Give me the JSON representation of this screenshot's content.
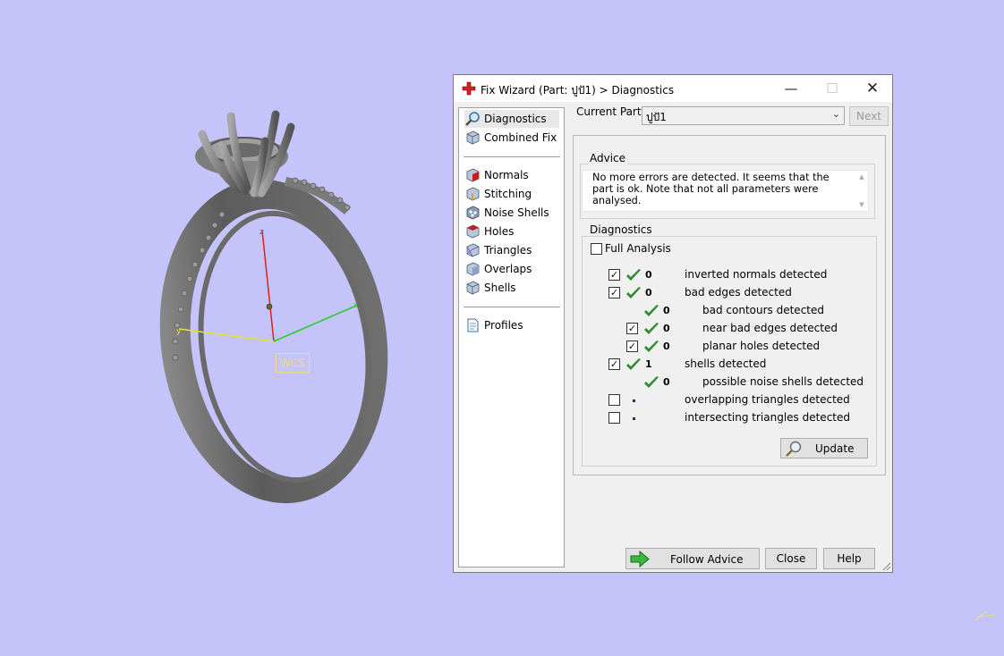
{
  "viewport": {
    "wcs_label": "WCS",
    "axes": {
      "z": "z",
      "x": "x",
      "y": "y"
    }
  },
  "dialog": {
    "title": "Fix Wizard (Part: ปูปั1) > Diagnostics",
    "nav": {
      "items": [
        {
          "label": "Diagnostics",
          "icon": "magnifier-icon",
          "selected": true
        },
        {
          "label": "Combined Fix",
          "icon": "cube-icon"
        },
        {
          "label": "Normals",
          "icon": "normals-cube-icon"
        },
        {
          "label": "Stitching",
          "icon": "stitching-cube-icon"
        },
        {
          "label": "Noise Shells",
          "icon": "noise-shells-icon"
        },
        {
          "label": "Holes",
          "icon": "holes-cube-icon"
        },
        {
          "label": "Triangles",
          "icon": "triangles-cube-icon"
        },
        {
          "label": "Overlaps",
          "icon": "overlaps-cube-icon"
        },
        {
          "label": "Shells",
          "icon": "shells-cube-icon"
        },
        {
          "label": "Profiles",
          "icon": "document-icon"
        }
      ]
    },
    "current_part": {
      "label": "Current Part:",
      "value": "ปูปั1"
    },
    "next_label": "Next",
    "advice": {
      "title": "Advice",
      "text": "No more errors are detected. It seems that the part is ok. Note that not all parameters were analysed."
    },
    "diagnostics": {
      "title": "Diagnostics",
      "full_analysis": {
        "label": "Full Analysis",
        "checked": false
      },
      "rows": [
        {
          "checkbox": true,
          "checked": true,
          "status": "ok",
          "count": "0",
          "text": "inverted normals detected",
          "indent": 0
        },
        {
          "checkbox": true,
          "checked": true,
          "status": "ok",
          "count": "0",
          "text": "bad edges detected",
          "indent": 0
        },
        {
          "checkbox": false,
          "checked": false,
          "status": "ok",
          "count": "0",
          "text": "bad contours detected",
          "indent": 1
        },
        {
          "checkbox": true,
          "checked": true,
          "status": "ok",
          "count": "0",
          "text": "near bad edges detected",
          "indent": 1
        },
        {
          "checkbox": true,
          "checked": true,
          "status": "ok",
          "count": "0",
          "text": "planar holes detected",
          "indent": 1
        },
        {
          "checkbox": true,
          "checked": true,
          "status": "ok",
          "count": "1",
          "text": "shells detected",
          "indent": 0
        },
        {
          "checkbox": false,
          "checked": false,
          "status": "ok",
          "count": "0",
          "text": "possible noise shells detected",
          "indent": 1
        },
        {
          "checkbox": true,
          "checked": false,
          "status": "pending",
          "count": "",
          "text": "overlapping triangles detected",
          "indent": 0
        },
        {
          "checkbox": true,
          "checked": false,
          "status": "pending",
          "count": "",
          "text": "intersecting triangles detected",
          "indent": 0
        }
      ],
      "update_label": "Update"
    },
    "buttons": {
      "follow_advice": "Follow Advice",
      "close": "Close",
      "help": "Help"
    },
    "colors": {
      "background": "#c4c4fb",
      "check_green": "#2e8b2e",
      "pending_dot": "#2020c0"
    }
  }
}
